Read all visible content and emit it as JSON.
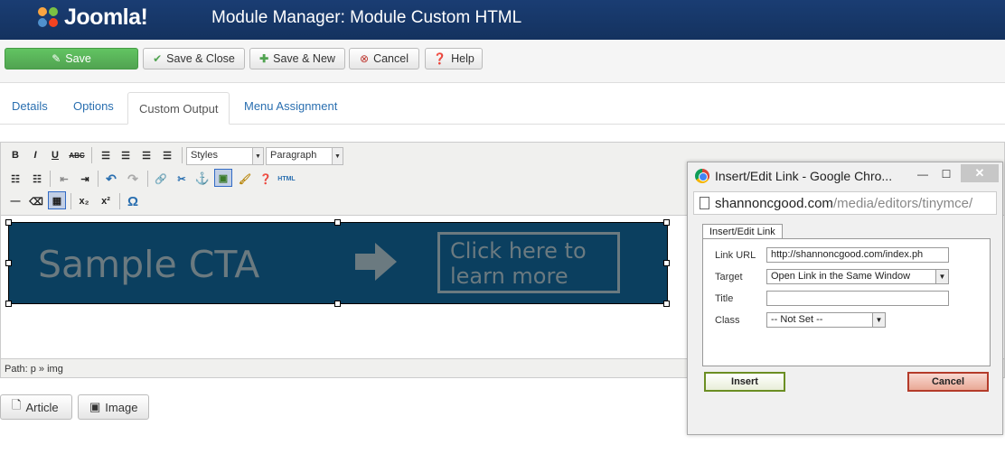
{
  "header": {
    "logo_text": "Joomla!",
    "title": "Module Manager: Module Custom HTML"
  },
  "toolbar": {
    "save": "Save",
    "save_close": "Save & Close",
    "save_new": "Save & New",
    "cancel": "Cancel",
    "help": "Help"
  },
  "tabs": [
    {
      "label": "Details"
    },
    {
      "label": "Options"
    },
    {
      "label": "Custom Output",
      "active": true
    },
    {
      "label": "Menu Assignment"
    }
  ],
  "editor": {
    "styles_select": "Styles",
    "format_select": "Paragraph",
    "html_button": "HTML",
    "path": "Path: p » img",
    "cta": {
      "main_text": "Sample CTA",
      "box_line1": "Click here to",
      "box_line2": "learn more"
    }
  },
  "bottom_buttons": {
    "article": "Article",
    "image": "Image"
  },
  "popup": {
    "title": "Insert/Edit Link - Google Chro...",
    "url_domain": "shannoncgood.com",
    "url_path": "/media/editors/tinymce/",
    "tab": "Insert/Edit Link",
    "fields": {
      "link_url_label": "Link URL",
      "link_url_value": "http://shannoncgood.com/index.ph",
      "target_label": "Target",
      "target_value": "Open Link in the Same Window",
      "title_label": "Title",
      "title_value": "",
      "class_label": "Class",
      "class_value": "-- Not Set --"
    },
    "insert": "Insert",
    "cancel": "Cancel"
  },
  "colors": {
    "header": "#1a3d73",
    "save": "#51a351",
    "cta_bg": "#0b3f5f",
    "link": "#2a6fb0"
  }
}
